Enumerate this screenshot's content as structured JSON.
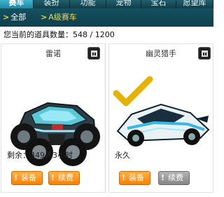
{
  "tabs": [
    {
      "label": "赛车",
      "active": true
    },
    {
      "label": "装扮",
      "active": false
    },
    {
      "label": "功能",
      "active": false
    },
    {
      "label": "宠物",
      "active": false
    },
    {
      "label": "宝石",
      "active": false
    },
    {
      "label": "愿望库",
      "active": false
    }
  ],
  "filters": {
    "all_label": "全部",
    "a_label": "A级赛车"
  },
  "inventory": {
    "text": "您当前的道具数量：548 / 1200"
  },
  "cars": [
    {
      "name": "雷诺",
      "remaining": "剩余：349天3小时",
      "equip_label": "装备",
      "renew_label": "续费",
      "renew_enabled": true,
      "equipped": false
    },
    {
      "name": "幽灵猎手",
      "remaining": "永久",
      "equip_label": "装备",
      "renew_label": "续费",
      "renew_enabled": false,
      "equipped": true
    }
  ],
  "colors": {
    "tab_active": "#2e9fbd",
    "header_dark": "#123c47",
    "accent_yellow": "#f2d52c",
    "button_orange": "#ff8c1a",
    "button_gray": "#9a9a9a"
  },
  "icons": [
    "chevron-right-icon",
    "trash-icon",
    "checkmark-icon",
    "exclamation-icon"
  ]
}
